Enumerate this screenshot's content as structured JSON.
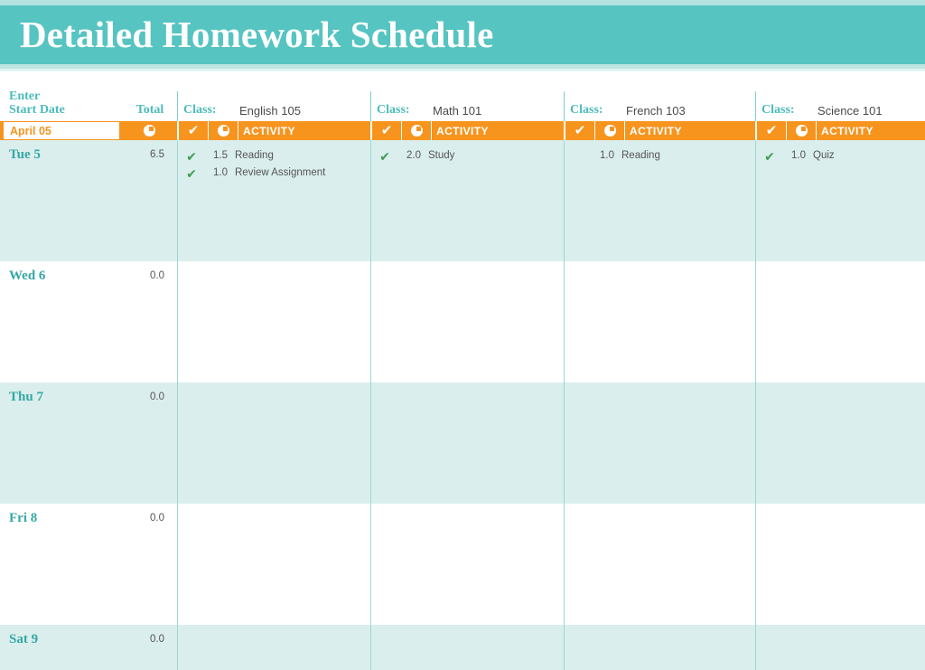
{
  "title": "Detailed Homework Schedule",
  "header": {
    "enter_start_date_line1": "Enter",
    "enter_start_date_line2": "Start Date",
    "total_label": "Total",
    "start_date_value": "April 05",
    "activity_label": "ACTIVITY",
    "class_label": "Class:",
    "icons": {
      "clock": "clock-icon",
      "check": "check-icon"
    }
  },
  "colors": {
    "banner_teal": "#56c4c1",
    "banner_teal_light": "#b4e0de",
    "orange": "#f7941e",
    "row_tint": "#daeeed",
    "teal_text": "#4cbcba",
    "day_text": "#35a7a4",
    "green_check": "#3f9c53",
    "body_text": "#555555",
    "separator": "#9bd6d4"
  },
  "classes": [
    {
      "label": "Class:",
      "name": "English 105"
    },
    {
      "label": "Class:",
      "name": "Math 101"
    },
    {
      "label": "Class:",
      "name": "French 103"
    },
    {
      "label": "Class:",
      "name": "Science 101"
    }
  ],
  "days": [
    {
      "name": "Tue 5",
      "total": "6.5",
      "columns": [
        [
          {
            "checked": true,
            "check": "✔",
            "hours": "1.5",
            "activity": "Reading"
          },
          {
            "checked": true,
            "check": "✔",
            "hours": "1.0",
            "activity": "Review Assignment"
          }
        ],
        [
          {
            "checked": true,
            "check": "✔",
            "hours": "2.0",
            "activity": "Study"
          }
        ],
        [
          {
            "checked": false,
            "check": "",
            "hours": "1.0",
            "activity": "Reading"
          }
        ],
        [
          {
            "checked": true,
            "check": "✔",
            "hours": "1.0",
            "activity": "Quiz"
          }
        ]
      ]
    },
    {
      "name": "Wed 6",
      "total": "0.0",
      "columns": [
        [],
        [],
        [],
        []
      ]
    },
    {
      "name": "Thu 7",
      "total": "0.0",
      "columns": [
        [],
        [],
        [],
        []
      ]
    },
    {
      "name": "Fri 8",
      "total": "0.0",
      "columns": [
        [],
        [],
        [],
        []
      ]
    },
    {
      "name": "Sat 9",
      "total": "0.0",
      "columns": [
        [],
        [],
        [],
        []
      ]
    }
  ]
}
